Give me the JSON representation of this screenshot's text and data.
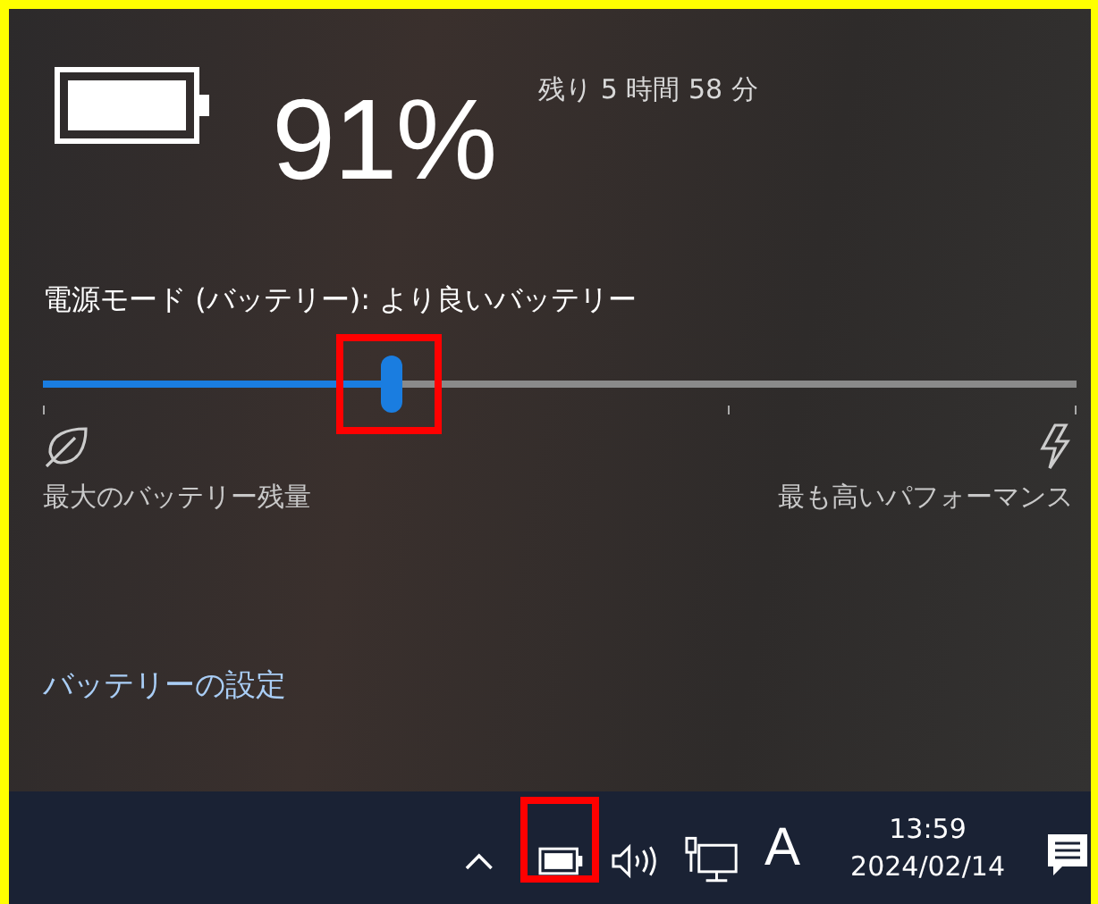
{
  "battery": {
    "percent": "91%",
    "remaining": "残り 5 時間 58 分"
  },
  "power_mode": {
    "title": "電源モード (バッテリー): より良いバッテリー",
    "level": 0.337,
    "left_label": "最大のバッテリー残量",
    "right_label": "最も高いパフォーマンス"
  },
  "settings_link": "バッテリーの設定",
  "taskbar": {
    "ime": "A",
    "time": "13:59",
    "date": "2024/02/14"
  }
}
